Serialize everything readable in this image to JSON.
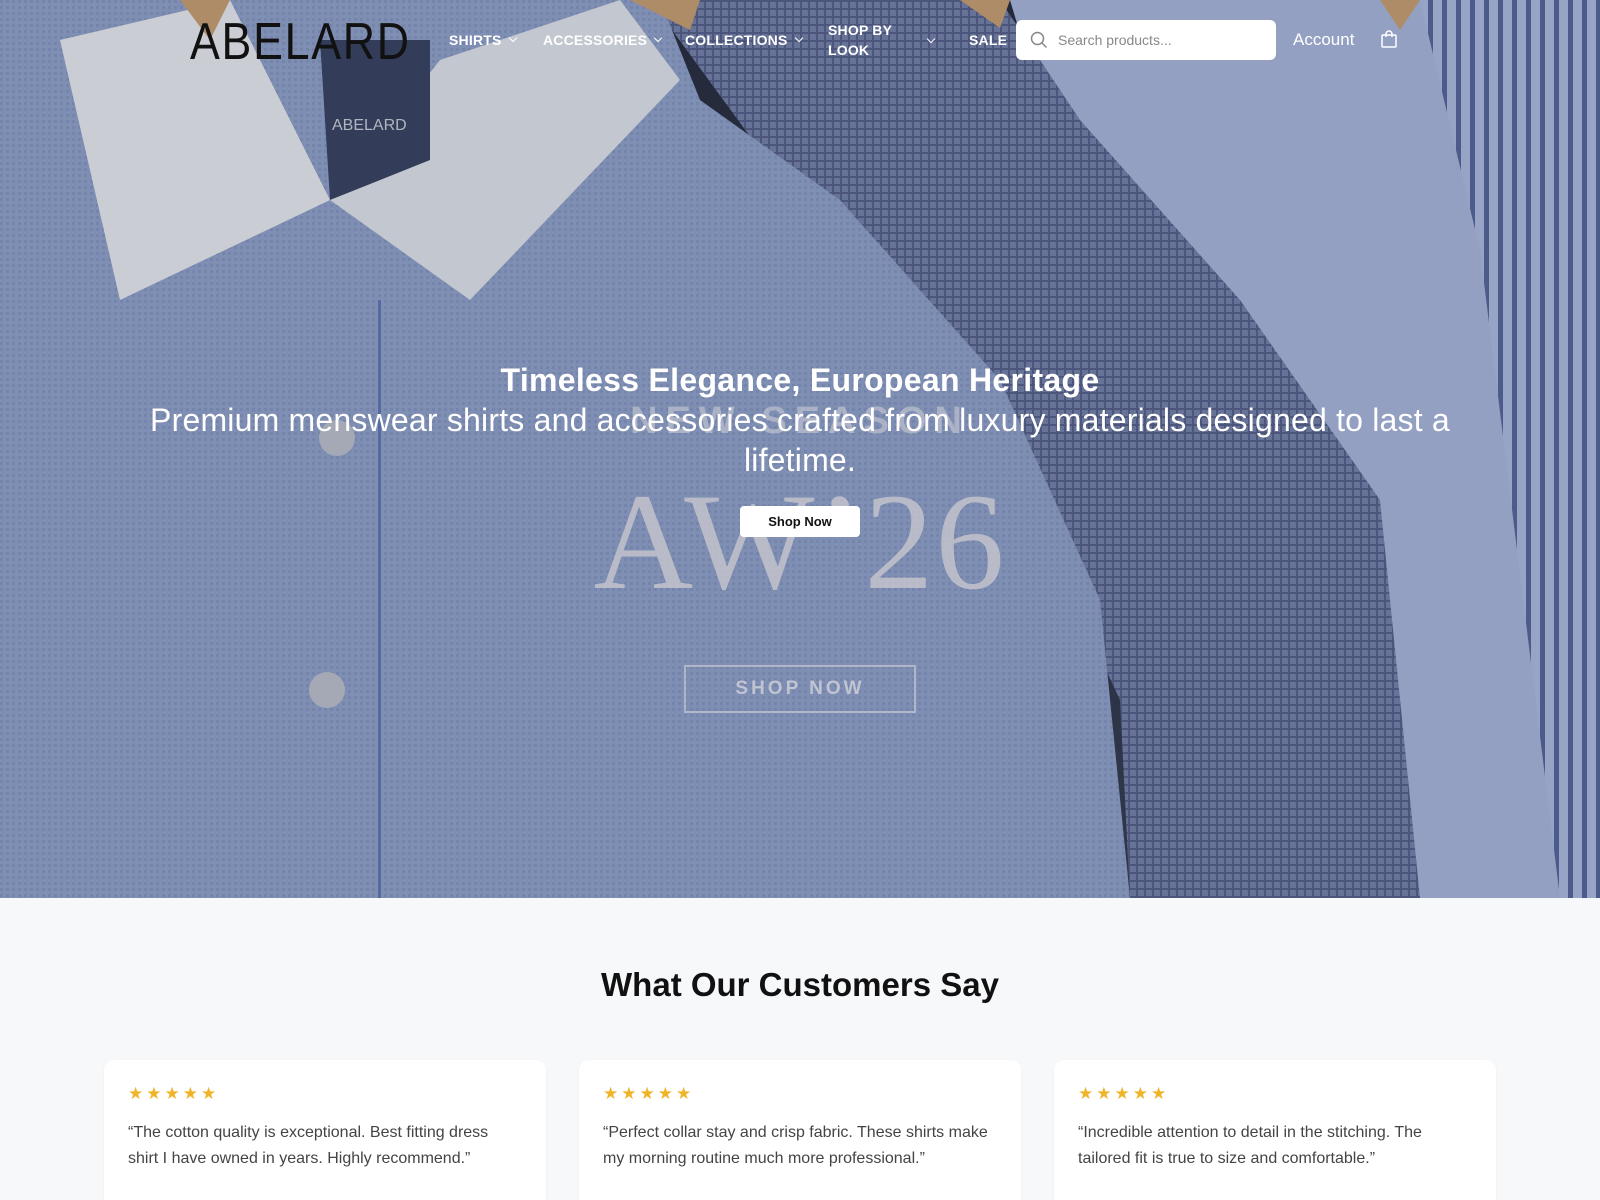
{
  "brand": {
    "logo_text": "ABELARD"
  },
  "nav": {
    "items": [
      {
        "label": "SHIRTS",
        "has_dropdown": true
      },
      {
        "label": "ACCESSORIES",
        "has_dropdown": true
      },
      {
        "label": "COLLECTIONS",
        "has_dropdown": true
      },
      {
        "label": "SHOP BY LOOK",
        "has_dropdown": true
      },
      {
        "label": "SALE",
        "has_dropdown": false
      }
    ],
    "search_placeholder": "Search products...",
    "account_label": "Account",
    "icons": [
      "search-icon",
      "bag-icon",
      "chevron-down-icon"
    ]
  },
  "hero": {
    "title": "Timeless Elegance, European Heritage",
    "subtitle": "Premium menswear shirts and accessories crafted from luxury materials designed to last a lifetime.",
    "cta_label": "Shop Now",
    "background": {
      "ghost_season": "NEW SEASON",
      "ghost_collection": "AW’26",
      "ghost_cta": "SHOP NOW",
      "label_text": "ABELARD"
    }
  },
  "testimonials": {
    "heading": "What Our Customers Say",
    "reviews": [
      {
        "rating": 5,
        "stars": "★★★★★",
        "quote": "“The cotton quality is exceptional. Best fitting dress shirt I have owned in years. Highly recommend.”"
      },
      {
        "rating": 5,
        "stars": "★★★★★",
        "quote": "“Perfect collar stay and crisp fabric. These shirts make my morning routine much more professional.”"
      },
      {
        "rating": 5,
        "stars": "★★★★★",
        "quote": "“Incredible attention to detail in the stitching. The tailored fit is true to size and comfortable.”"
      }
    ]
  },
  "colors": {
    "star": "#f0b429",
    "page_bg": "#f7f8fa",
    "heading": "#111111"
  }
}
